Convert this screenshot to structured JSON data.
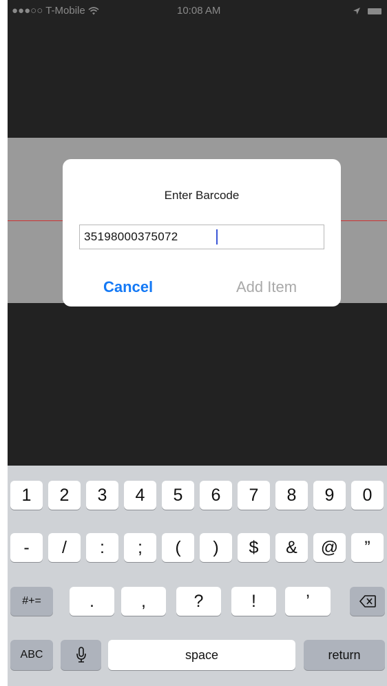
{
  "status_bar": {
    "carrier": "●●●○○ T-Mobile",
    "wifi_icon": "wifi-icon",
    "time": "10:08 AM",
    "location_icon": "location-arrow-icon",
    "battery_icon": "battery-icon"
  },
  "dialog": {
    "title": "Enter Barcode",
    "barcode_value": "35198000375072",
    "cancel_label": "Cancel",
    "add_item_label": "Add Item"
  },
  "keyboard": {
    "row1": [
      "1",
      "2",
      "3",
      "4",
      "5",
      "6",
      "7",
      "8",
      "9",
      "0"
    ],
    "row2": [
      "-",
      "/",
      ":",
      ";",
      "(",
      ")",
      "$",
      "&",
      "@",
      "”"
    ],
    "row3": {
      "symbols_toggle": "#+=",
      "keys": [
        ".",
        ",",
        "?",
        "!",
        "’"
      ],
      "delete_icon": "backspace-icon"
    },
    "row4": {
      "abc_label": "ABC",
      "mic_icon": "microphone-icon",
      "space_label": "space",
      "return_label": "return"
    }
  },
  "colors": {
    "accent": "#1479f5",
    "disabled": "#a9a9a9",
    "scan_line": "#cc3333"
  }
}
